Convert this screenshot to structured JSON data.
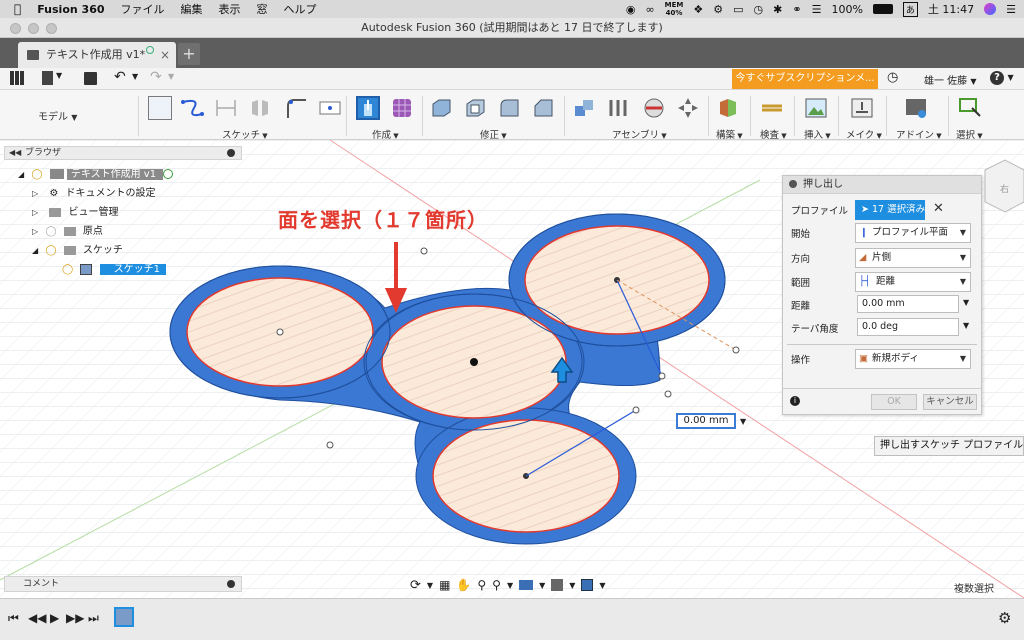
{
  "menubar": {
    "app": "Fusion 360",
    "items": [
      "ファイル",
      "編集",
      "表示",
      "窓",
      "ヘルプ"
    ],
    "mem_label": "MEM",
    "mem_value": "40%",
    "battery": "100%",
    "ime": "あ",
    "time": "土 11:47"
  },
  "window": {
    "title": "Autodesk Fusion 360 (試用期間はあと 17 日で終了します)"
  },
  "tab": {
    "name": "テキスト作成用 v1*"
  },
  "qat": {
    "subscribe": "今すぐサブスクリプションメ...",
    "user": "雄一 佐藤",
    "help": "?"
  },
  "ribbon": {
    "workspace": "モデル",
    "groups": [
      "スケッチ",
      "作成",
      "修正",
      "アセンブリ",
      "構築",
      "検査",
      "挿入",
      "メイク",
      "アドイン",
      "選択"
    ]
  },
  "browser": {
    "title": "ブラウザ",
    "root": "テキスト作成用 v1",
    "items": [
      "ドキュメントの設定",
      "ビュー管理",
      "原点",
      "スケッチ",
      "スケッチ1"
    ]
  },
  "annotation": "面を選択（１７箇所）",
  "dialog": {
    "title": "押し出し",
    "rows": [
      {
        "label": "プロファイル",
        "value": "17 選択済み"
      },
      {
        "label": "開始",
        "value": "プロファイル平面"
      },
      {
        "label": "方向",
        "value": "片側"
      },
      {
        "label": "範囲",
        "value": "距離"
      },
      {
        "label": "距離",
        "value": "0.00 mm"
      },
      {
        "label": "テーパ角度",
        "value": "0.0 deg"
      },
      {
        "label": "操作",
        "value": "新規ボディ"
      }
    ],
    "ok": "OK",
    "cancel": "キャンセル"
  },
  "dimension": "0.00 mm",
  "tooltip": "押し出すスケッチ プロファイル",
  "comment": "コメント",
  "multiselect": "複数選択",
  "colors": {
    "accent": "#f39c1f",
    "select": "#1e8ee0",
    "shape_fill": "#3a78d4",
    "profile": "#fbe9da",
    "red": "#e23a2e"
  }
}
